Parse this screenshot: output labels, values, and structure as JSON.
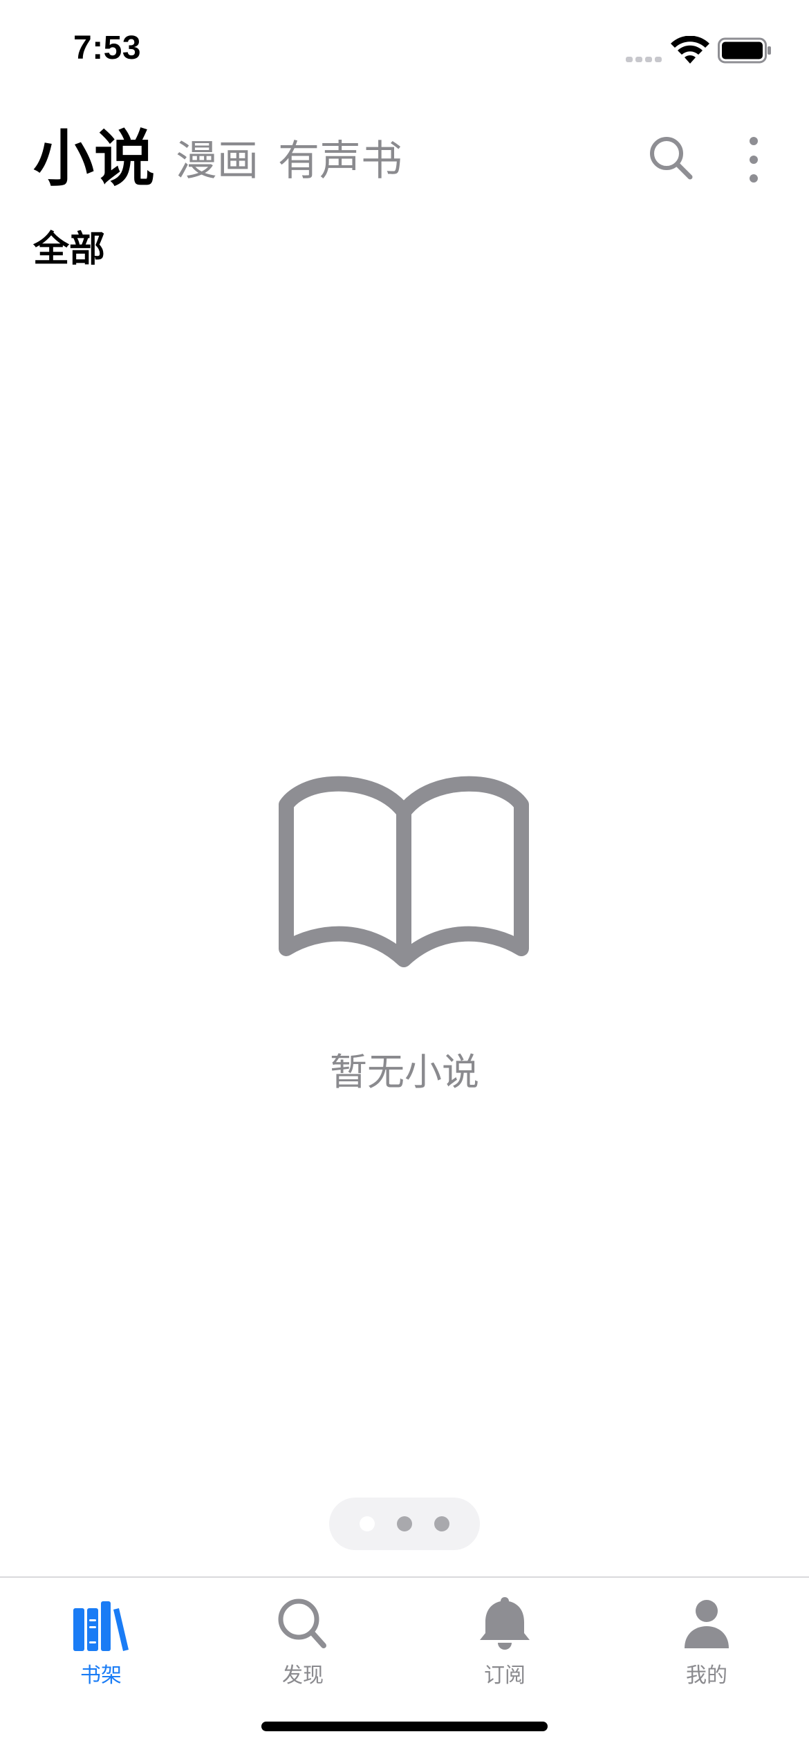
{
  "status_bar": {
    "time": "7:53",
    "icons": [
      "cellular-signal-icon",
      "wifi-icon",
      "battery-icon"
    ]
  },
  "header": {
    "tabs": [
      {
        "label": "小说",
        "active": true
      },
      {
        "label": "漫画",
        "active": false
      },
      {
        "label": "有声书",
        "active": false
      }
    ],
    "actions": [
      "search-icon",
      "more-vertical-icon"
    ],
    "filter_label": "全部"
  },
  "empty_state": {
    "icon": "open-book-icon",
    "message": "暂无小说"
  },
  "page_indicator": {
    "pages": 3,
    "current_page": 1
  },
  "tab_bar": {
    "items": [
      {
        "label": "书架",
        "icon": "bookshelf-icon",
        "active": true
      },
      {
        "label": "发现",
        "icon": "search-icon",
        "active": false
      },
      {
        "label": "订阅",
        "icon": "bell-icon",
        "active": false
      },
      {
        "label": "我的",
        "icon": "person-icon",
        "active": false
      }
    ]
  },
  "colors": {
    "accent": "#1a7cf5",
    "secondary_text": "#8a8a8e",
    "icon_gray": "#8e8e93",
    "background": "#ffffff"
  }
}
